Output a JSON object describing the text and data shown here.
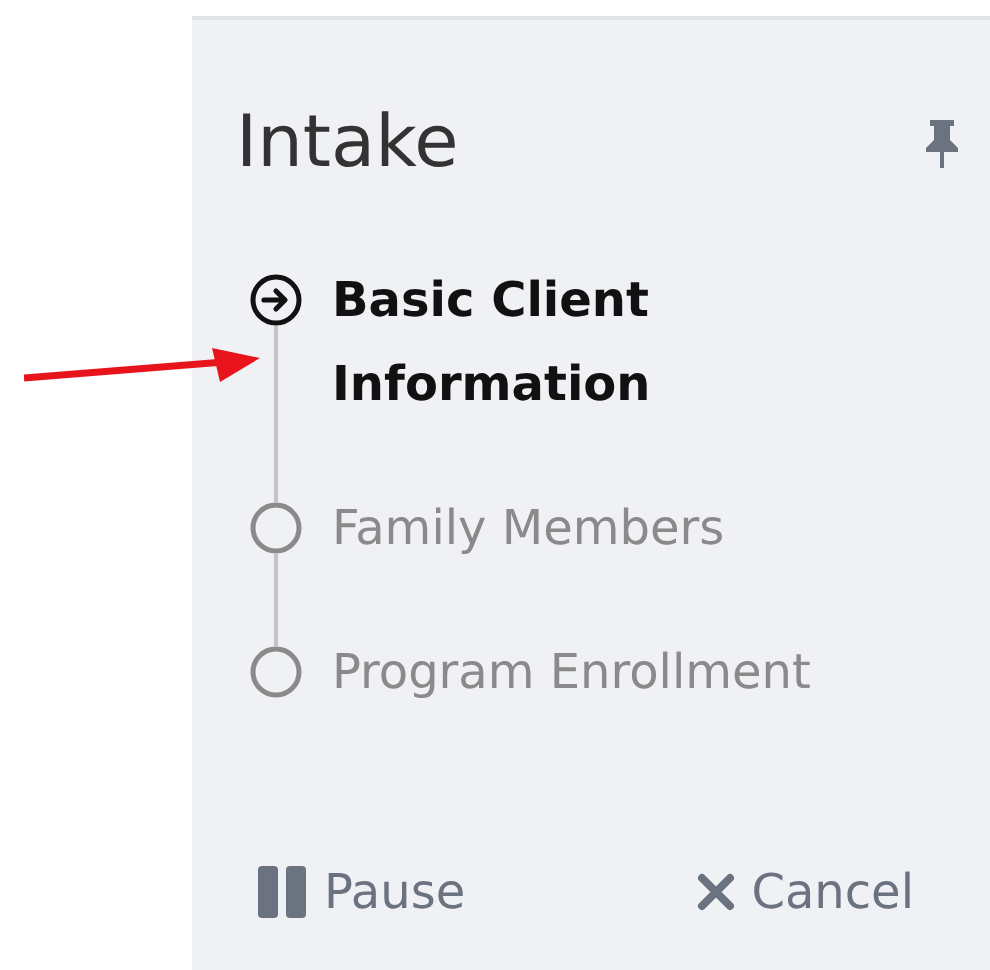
{
  "panel": {
    "title": "Intake",
    "steps": [
      {
        "label": "Basic Client Information",
        "selected": true
      },
      {
        "label": "Family Members",
        "selected": false
      },
      {
        "label": "Program Enrollment",
        "selected": false
      }
    ],
    "buttons": [
      {
        "kind": "pause",
        "label": "Pause"
      },
      {
        "kind": "cancel",
        "label": "Cancel"
      }
    ]
  }
}
